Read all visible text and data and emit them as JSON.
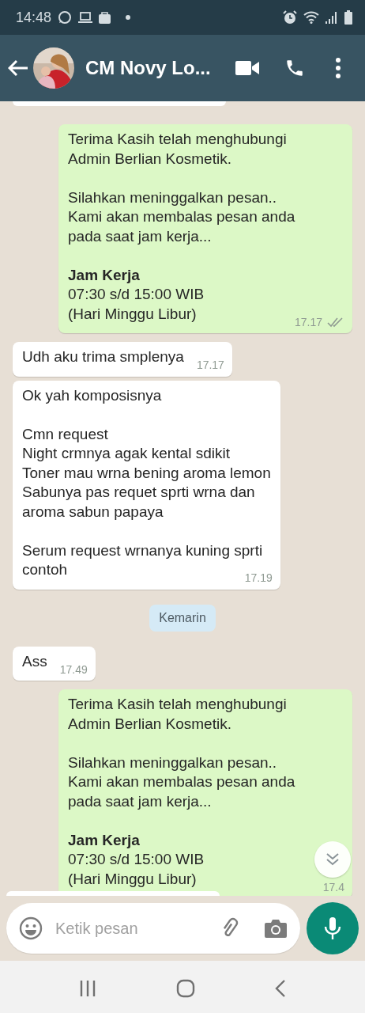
{
  "status_bar": {
    "time": "14:48"
  },
  "header": {
    "name": "CM Novy Lo..."
  },
  "messages": [
    {
      "kind": "out",
      "text": "Terima Kasih telah menghubungi\nAdmin Berlian Kosmetik.\n\nSilahkan meninggalkan pesan..\nKami akan membalas pesan anda\npada saat jam kerja...\n\n**Jam Kerja**\n07:30 s/d 15:00 WIB\n(Hari Minggu Libur)",
      "time": "17.17",
      "read": true
    },
    {
      "kind": "in",
      "text": "Udh aku trima smplenya",
      "time": "17.17"
    },
    {
      "kind": "in",
      "text": "Ok yah komposisnya\n\nCmn request\nNight crmnya agak kental sdikit\nToner mau wrna bening aroma lemon\nSabunya pas requet sprti wrna dan\naroma sabun papaya\n\nSerum request wrnanya kuning sprti\ncontoh",
      "time": "17.19"
    },
    {
      "kind": "date",
      "text": "Kemarin"
    },
    {
      "kind": "in",
      "text": "Ass",
      "time": "17.49"
    },
    {
      "kind": "out",
      "text": "Terima Kasih telah menghubungi\nAdmin Berlian Kosmetik.\n\nSilahkan meninggalkan pesan..\nKami akan membalas pesan anda\npada saat jam kerja...\n\n**Jam Kerja**\n07:30 s/d 15:00 WIB\n(Hari Minggu Libur)",
      "time": "17.4",
      "read": false
    }
  ],
  "composer": {
    "placeholder": "Ketik pesan"
  }
}
